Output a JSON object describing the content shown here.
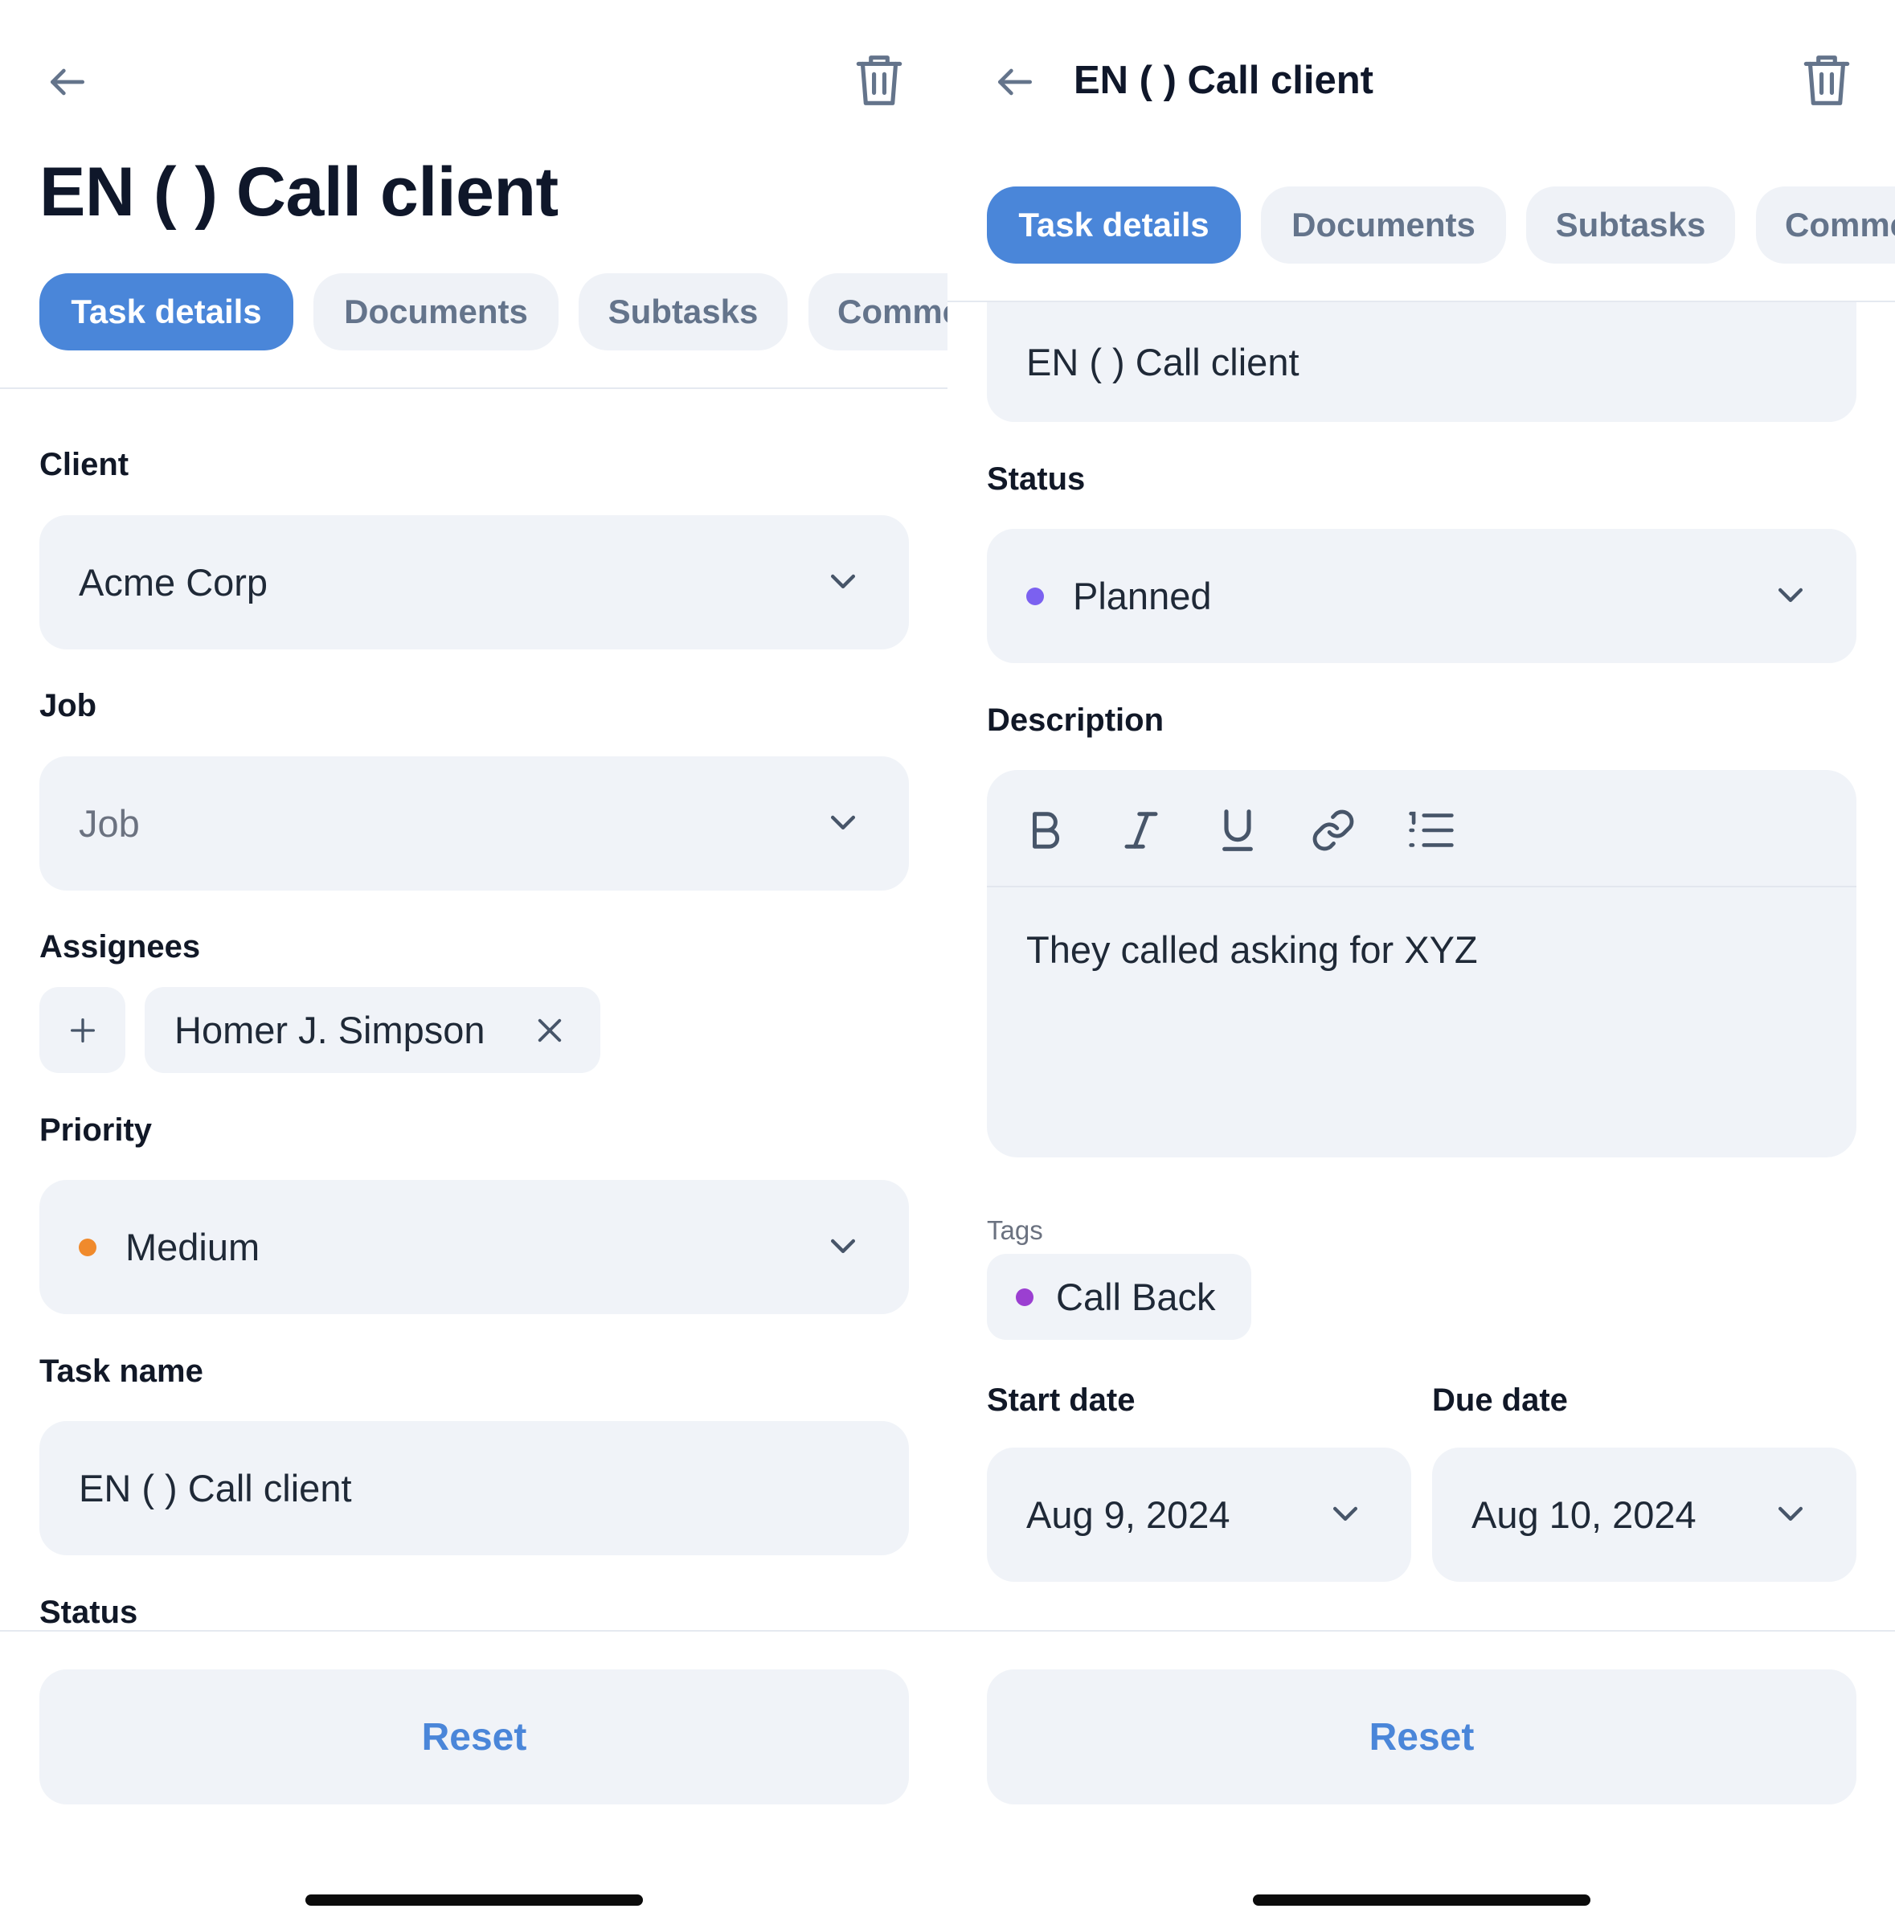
{
  "left": {
    "title": "EN ( ) Call client",
    "tabs": [
      {
        "label": "Task details",
        "active": true
      },
      {
        "label": "Documents",
        "active": false
      },
      {
        "label": "Subtasks",
        "active": false
      },
      {
        "label": "Comments",
        "active": false
      }
    ],
    "client": {
      "label": "Client",
      "value": "Acme Corp"
    },
    "job": {
      "label": "Job",
      "placeholder": "Job"
    },
    "assignees": {
      "label": "Assignees",
      "people": [
        "Homer J. Simpson"
      ]
    },
    "priority": {
      "label": "Priority",
      "value": "Medium",
      "color": "#f08a2c"
    },
    "task_name": {
      "label": "Task name",
      "value": "EN ( ) Call client"
    },
    "status_label": "Status",
    "reset_label": "Reset"
  },
  "right": {
    "title": "EN ( ) Call client",
    "tabs": [
      {
        "label": "Task details",
        "active": true
      },
      {
        "label": "Documents",
        "active": false
      },
      {
        "label": "Subtasks",
        "active": false
      },
      {
        "label": "Comments",
        "active": false
      }
    ],
    "task_name_value": "EN ( ) Call client",
    "status": {
      "label": "Status",
      "value": "Planned",
      "color": "#7b61f0"
    },
    "description": {
      "label": "Description",
      "text": "They called asking for XYZ",
      "toolbar": [
        "bold-icon",
        "italic-icon",
        "underline-icon",
        "link-icon",
        "numbered-list-icon"
      ]
    },
    "tags": {
      "label": "Tags",
      "items": [
        {
          "name": "Call Back",
          "color": "#9b3fd1"
        }
      ]
    },
    "start_date": {
      "label": "Start date",
      "value": "Aug 9, 2024"
    },
    "due_date": {
      "label": "Due date",
      "value": "Aug 10, 2024"
    },
    "reset_label": "Reset"
  },
  "colors": {
    "accent": "#4a86d9",
    "field_bg": "#f0f3f8",
    "text_primary": "#111827",
    "text_muted": "#64748b"
  }
}
